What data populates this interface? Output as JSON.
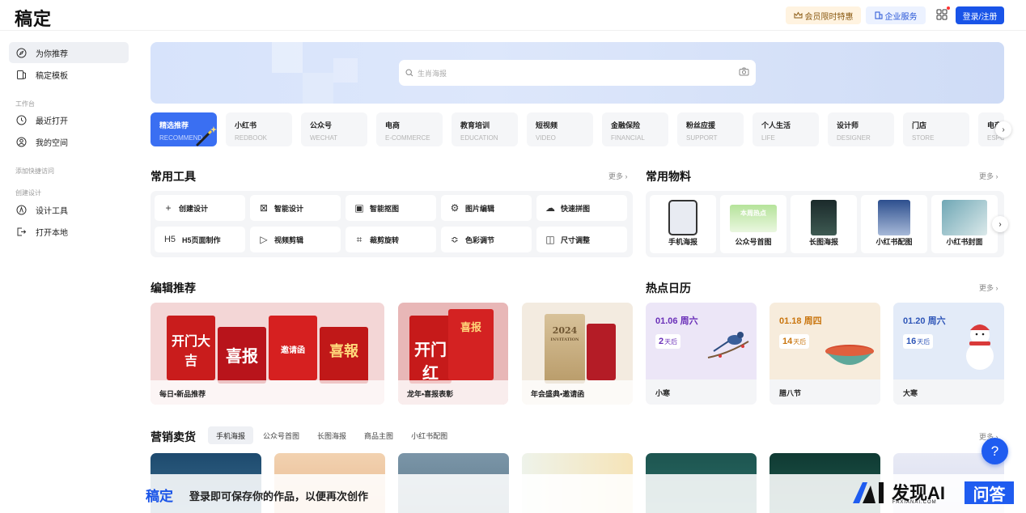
{
  "header": {
    "logo": "稿定",
    "vip_label": "会员限时特惠",
    "enterprise_label": "企业服务",
    "login_label": "登录/注册"
  },
  "sidebar": {
    "items_top": [
      {
        "label": "为你推荐",
        "icon": "compass-icon"
      },
      {
        "label": "稿定模板",
        "icon": "template-icon"
      }
    ],
    "workspace_group": "工作台",
    "items_work": [
      {
        "label": "最近打开",
        "icon": "clock-icon"
      },
      {
        "label": "我的空间",
        "icon": "user-space-icon"
      }
    ],
    "quick_access_group": "添加快捷访问",
    "create_group": "创建设计",
    "items_create": [
      {
        "label": "设计工具",
        "icon": "design-tool-icon"
      },
      {
        "label": "打开本地",
        "icon": "open-local-icon"
      }
    ]
  },
  "search": {
    "placeholder": "生肖海报"
  },
  "categories": [
    {
      "cn": "精选推荐",
      "en": "RECOMMEND"
    },
    {
      "cn": "小红书",
      "en": "REDBOOK"
    },
    {
      "cn": "公众号",
      "en": "WECHAT"
    },
    {
      "cn": "电商",
      "en": "E-COMMERCE"
    },
    {
      "cn": "教育培训",
      "en": "EDUCATION"
    },
    {
      "cn": "短视频",
      "en": "VIDEO"
    },
    {
      "cn": "金融保险",
      "en": "FINANCIAL"
    },
    {
      "cn": "粉丝应援",
      "en": "SUPPORT"
    },
    {
      "cn": "个人生活",
      "en": "LIFE"
    },
    {
      "cn": "设计师",
      "en": "DESIGNER"
    },
    {
      "cn": "门店",
      "en": "STORE"
    },
    {
      "cn": "电商",
      "en": "ESPORTS"
    }
  ],
  "tools_section": {
    "title": "常用工具",
    "more": "更多 ›",
    "tools": [
      {
        "label": "创建设计",
        "glyph": "+"
      },
      {
        "label": "智能设计",
        "glyph": "⊠"
      },
      {
        "label": "智能抠图",
        "glyph": "▣"
      },
      {
        "label": "图片编辑",
        "glyph": "⚙"
      },
      {
        "label": "快速拼图",
        "glyph": "☁"
      },
      {
        "label": "H5页面制作",
        "glyph": "H5"
      },
      {
        "label": "视频剪辑",
        "glyph": "▷"
      },
      {
        "label": "裁剪旋转",
        "glyph": "⌗"
      },
      {
        "label": "色彩调节",
        "glyph": "≎"
      },
      {
        "label": "尺寸调整",
        "glyph": "◫"
      }
    ]
  },
  "materials_section": {
    "title": "常用物料",
    "more": "更多 ›",
    "items": [
      "手机海报",
      "公众号首图",
      "长图海报",
      "小红书配图",
      "小红书封面"
    ],
    "thumb_texts": [
      "本周热点"
    ]
  },
  "editor_section": {
    "title": "编辑推荐",
    "cards": [
      {
        "caption": "每日•新品推荐",
        "poster_texts": [
          "开门大吉",
          "喜报",
          "邀请函",
          "喜報"
        ]
      },
      {
        "caption": "龙年•喜报表彰",
        "poster_texts": [
          "开门红",
          "喜报"
        ]
      },
      {
        "caption": "年会盛典•邀请函",
        "poster_texts": [
          "2024",
          "INVITATION"
        ]
      }
    ]
  },
  "calendar_section": {
    "title": "热点日历",
    "more": "更多 ›",
    "cards": [
      {
        "date": "01.06 周六",
        "num": "2",
        "suffix": "天后",
        "name": "小寒",
        "color": "#6a2fb8",
        "bg": "#ece6f7"
      },
      {
        "date": "01.18 周四",
        "num": "14",
        "suffix": "天后",
        "name": "腊八节",
        "color": "#c9750e",
        "bg": "#f7ecdc"
      },
      {
        "date": "01.20 周六",
        "num": "16",
        "suffix": "天后",
        "name": "大寒",
        "color": "#2f56b8",
        "bg": "#e3ebf8"
      }
    ]
  },
  "marketing_section": {
    "title": "营销卖货",
    "more": "更多 ›",
    "tabs": [
      "手机海报",
      "公众号首图",
      "长图海报",
      "商品主图",
      "小红书配图"
    ]
  },
  "bottom_bar": {
    "logo": "稿定",
    "message": "登录即可保存你的作品，以便再次创作"
  },
  "watermark": {
    "title": "发现AI",
    "subtitle": "FAXIANAI.COM",
    "qa": "问答"
  },
  "help": {
    "label": "?"
  },
  "colors": {
    "accent": "#1954e8",
    "vip": "#fff3e0",
    "active_category": "#3a6ff2"
  }
}
